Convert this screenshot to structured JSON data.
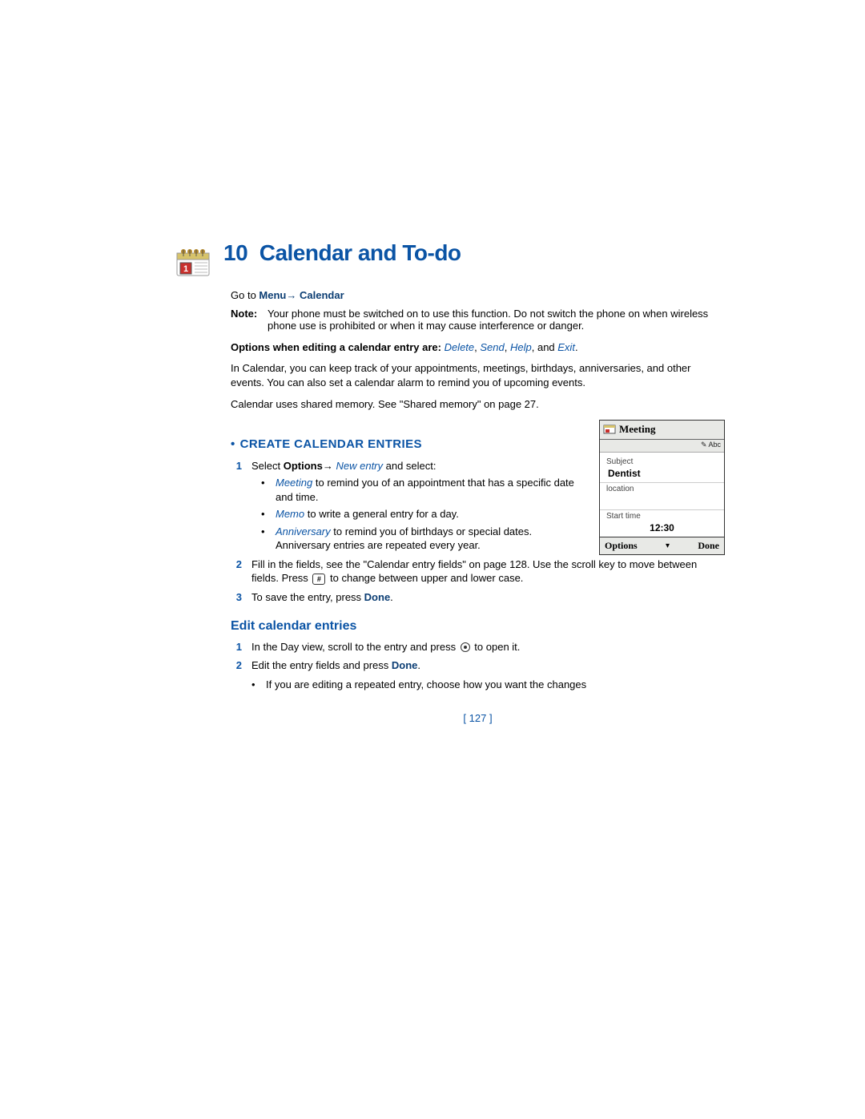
{
  "chapter": {
    "number": "10",
    "title": "Calendar and To-do"
  },
  "goto": {
    "prefix": "Go to ",
    "menu": "Menu",
    "arrow": "→ ",
    "calendar": "Calendar"
  },
  "note": {
    "label": "Note:",
    "body": "Your phone must be switched on to use this function. Do not switch the phone on when wireless phone use is prohibited or when it may cause interference or danger."
  },
  "options_line": {
    "prefix": "Options when editing a calendar entry are: ",
    "delete": "Delete",
    "send": "Send",
    "help": "Help",
    "and": ", and ",
    "exit": "Exit",
    "period": "."
  },
  "para1": "In Calendar, you can keep track of your appointments, meetings, birthdays, anniversaries, and other events. You can also set a calendar alarm to remind you of upcoming events.",
  "para2": "Calendar uses shared memory. See \"Shared memory\" on page 27.",
  "section1": {
    "title": "CREATE CALENDAR ENTRIES",
    "steps": [
      {
        "num": "1",
        "select": "Select ",
        "options": "Options",
        "arrow": "→ ",
        "newentry": "New entry",
        "tail": " and select:",
        "bullets": [
          {
            "term": "Meeting",
            "rest": " to remind you of an appointment that has a specific date and time."
          },
          {
            "term": "Memo",
            "rest": " to write a general entry for a day."
          },
          {
            "term": "Anniversary",
            "rest": " to remind you of birthdays or special dates. Anniversary entries are repeated every year."
          }
        ]
      },
      {
        "num": "2",
        "body_pre": "Fill in the fields, see the \"Calendar entry fields\" on page 128. Use the scroll key to move between fields. Press ",
        "body_post": " to change between upper and lower case."
      },
      {
        "num": "3",
        "body_pre": "To save the entry, press ",
        "done": "Done",
        "period": "."
      }
    ]
  },
  "section2": {
    "title": "Edit calendar entries",
    "steps": [
      {
        "num": "1",
        "body_pre": "In the Day view, scroll to the entry and press ",
        "body_post": " to open it."
      },
      {
        "num": "2",
        "body_pre": "Edit the entry fields and press ",
        "done": "Done",
        "period": "."
      }
    ],
    "bullet": "If you are editing a repeated entry, choose how you want the changes"
  },
  "screenshot": {
    "title": "Meeting",
    "status": "✎ Abc",
    "subject_label": "Subject",
    "subject_value": "Dentist",
    "location_label": "location",
    "starttime_label": "Start time",
    "starttime_value": "12:30",
    "options": "Options",
    "done": "Done"
  },
  "footer": "[ 127 ]",
  "icons": {
    "hash": "#"
  }
}
